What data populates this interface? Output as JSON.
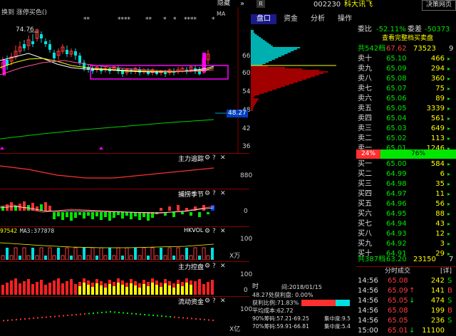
{
  "chart": {
    "top_left": "换到 涨停买色()",
    "hidden_label": "隐藏",
    "hide_arrow": "»",
    "ma_label": "MA",
    "high_label": "74.76",
    "stars": [
      "**",
      "****",
      "**",
      "*",
      "*",
      "****",
      "*"
    ],
    "price_ticks": [
      "66",
      "60",
      "54",
      "48",
      "42",
      "36"
    ],
    "current_price_tag": "48.27",
    "vol_axis_ticks": [
      "880"
    ],
    "zero_labels": [
      "0",
      "0",
      "0"
    ],
    "hundred_labels": [
      "100",
      "100",
      "100"
    ],
    "unit_wan": "X万",
    "unit_yi": "X亿",
    "panels": [
      {
        "title": "主力追踪"
      },
      {
        "title": "捕捞季节"
      },
      {
        "title": "HKVOL"
      },
      {
        "title": "主力控盘"
      },
      {
        "title": "流动资金"
      }
    ],
    "vol_left_label": "97542",
    "vol_ma_label": "MA3:377878",
    "info": {
      "time_label": "时",
      "date_label": "间:2018/01/15",
      "profit_line": "48.27处获利盘: 0.00%",
      "ratio_line": "获利比例:71.83%",
      "avg_cost": "平均成本:62.72",
      "chip90": "90%筹码:57.21-69.25",
      "conc90": "集中度:9.5",
      "chip70": "70%筹码:59.91-66.81",
      "conc70": "集中度:5.4"
    }
  },
  "side": {
    "code_badge": "R",
    "stock_code": "002230",
    "stock_name": "科大讯飞",
    "decision_btn": "决策网页",
    "tabs": [
      "盘口",
      "资金",
      "分析",
      "操作"
    ],
    "wei_bi_label": "委比",
    "wei_bi_value": "-52.11%",
    "wei_cha_label": "委差",
    "wei_cha_value": "-50373",
    "book_title": "查看完整档买卖盘",
    "total_row": {
      "label": "共542档",
      "price": "67.62",
      "vol": "73523",
      "n": "9"
    },
    "sells": [
      {
        "label": "卖十",
        "price": "65.10",
        "vol": "466"
      },
      {
        "label": "卖九",
        "price": "65.09",
        "vol": "294"
      },
      {
        "label": "卖八",
        "price": "65.08",
        "vol": "360"
      },
      {
        "label": "卖七",
        "price": "65.07",
        "vol": "75"
      },
      {
        "label": "卖六",
        "price": "65.06",
        "vol": "89"
      },
      {
        "label": "卖五",
        "price": "65.05",
        "vol": "3339"
      },
      {
        "label": "卖四",
        "price": "65.04",
        "vol": "561"
      },
      {
        "label": "卖三",
        "price": "65.03",
        "vol": "649"
      },
      {
        "label": "卖二",
        "price": "65.02",
        "vol": "113"
      },
      {
        "label": "卖一",
        "price": "65.01",
        "vol": "1246"
      }
    ],
    "ratio_left": "24%",
    "ratio_right": "76%",
    "buys": [
      {
        "label": "买一",
        "price": "65.00",
        "vol": "584"
      },
      {
        "label": "买二",
        "price": "64.99",
        "vol": "6"
      },
      {
        "label": "买三",
        "price": "64.98",
        "vol": "35"
      },
      {
        "label": "买四",
        "price": "64.97",
        "vol": "11"
      },
      {
        "label": "买五",
        "price": "64.96",
        "vol": "56"
      },
      {
        "label": "买六",
        "price": "64.95",
        "vol": "88"
      },
      {
        "label": "买七",
        "price": "64.94",
        "vol": "43"
      },
      {
        "label": "买八",
        "price": "64.93",
        "vol": "12"
      },
      {
        "label": "买九",
        "price": "64.92",
        "vol": "3"
      },
      {
        "label": "买十",
        "price": "64.91",
        "vol": "29"
      }
    ],
    "buy_total": {
      "label": "共387档",
      "price": "63.20",
      "vol": "23150",
      "n": "7"
    },
    "ticks_title": "分时成交",
    "ticks_btn": "[详]",
    "ticks": [
      {
        "time": "14:56",
        "price": "65.08",
        "vol": "242",
        "dir": "S",
        "arrow": ""
      },
      {
        "time": "14:56",
        "price": "65.09",
        "vol": "141",
        "dir": "B",
        "arrow": "↑"
      },
      {
        "time": "14:56",
        "price": "65.05",
        "vol": "474",
        "dir": "S",
        "arrow": "↓"
      },
      {
        "time": "14:56",
        "price": "65.08",
        "vol": "199",
        "dir": "B",
        "arrow": ""
      },
      {
        "time": "14:56",
        "price": "65.05",
        "vol": "236",
        "dir": "S",
        "arrow": ""
      },
      {
        "time": "15:00",
        "price": "65.01",
        "vol": "11100",
        "dir": "",
        "arrow": "↓"
      }
    ],
    "colors": {
      "up": "#ff3c3c",
      "down": "#00e600",
      "header_red": "#8b0000",
      "accent_yellow": "#ffff00",
      "cyan": "#00ffff",
      "magenta": "#ff00ff"
    }
  }
}
